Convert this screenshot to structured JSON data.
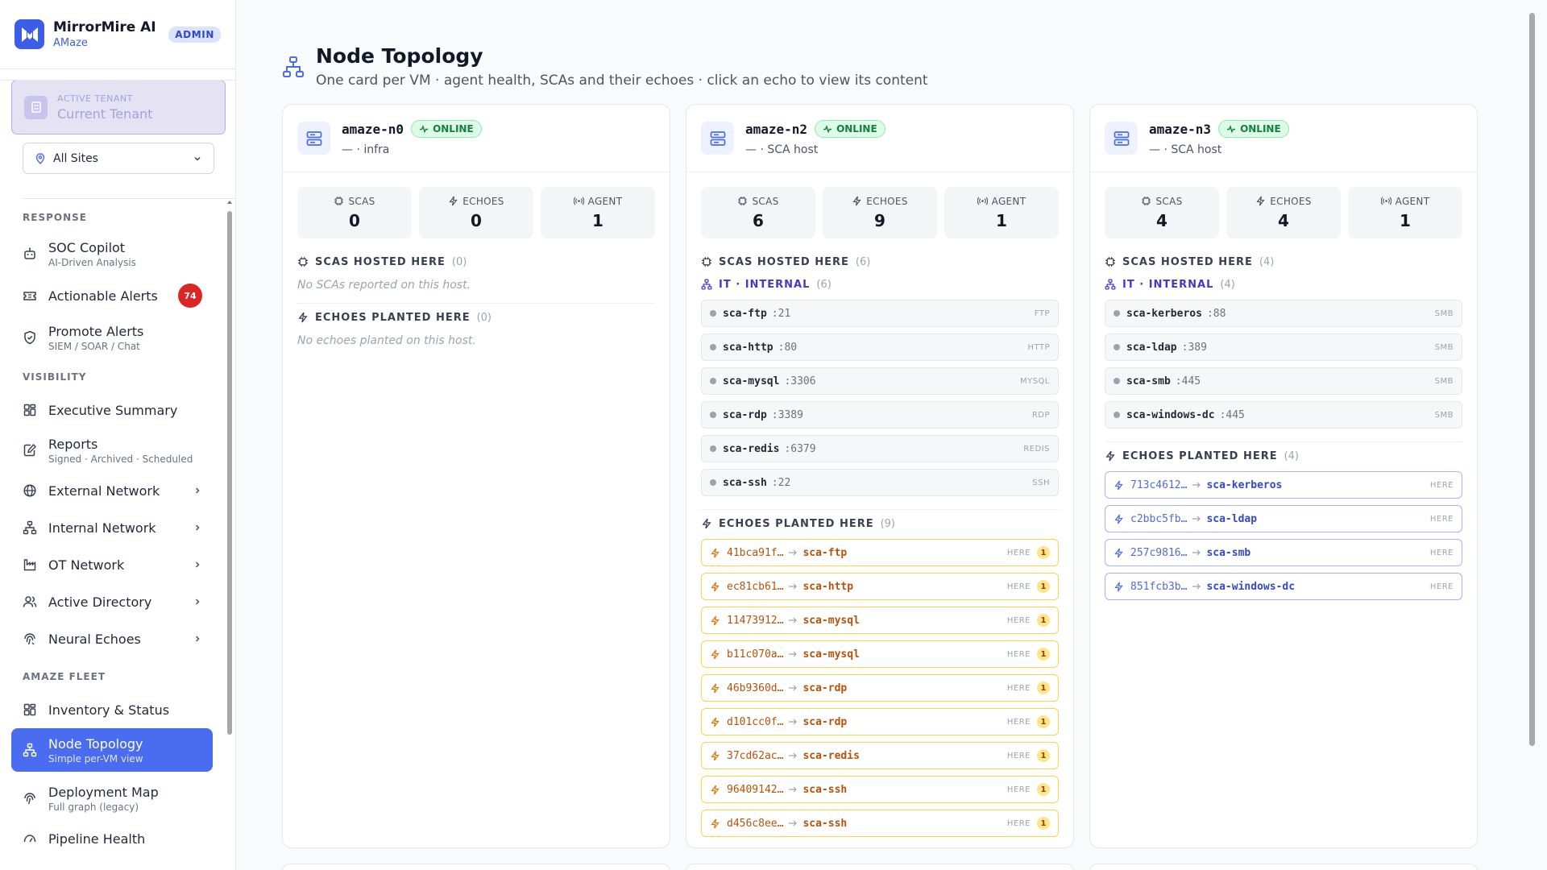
{
  "brand": {
    "name": "MirrorMire AI",
    "sub": "AMaze",
    "badge": "ADMIN"
  },
  "tenant": {
    "label": "ACTIVE TENANT",
    "value": "Current Tenant"
  },
  "site_select": {
    "value": "All Sites"
  },
  "nav": {
    "response": "RESPONSE",
    "soc_copilot": {
      "title": "SOC Copilot",
      "sub": "AI-Driven Analysis"
    },
    "actionable_alerts": {
      "title": "Actionable Alerts",
      "badge": "74"
    },
    "promote_alerts": {
      "title": "Promote Alerts",
      "sub": "SIEM / SOAR / Chat"
    },
    "visibility": "VISIBILITY",
    "executive_summary": {
      "title": "Executive Summary"
    },
    "reports": {
      "title": "Reports",
      "sub": "Signed · Archived · Scheduled"
    },
    "external_network": {
      "title": "External Network"
    },
    "internal_network": {
      "title": "Internal Network"
    },
    "ot_network": {
      "title": "OT Network"
    },
    "active_directory": {
      "title": "Active Directory"
    },
    "neural_echoes": {
      "title": "Neural Echoes"
    },
    "amaze_fleet": "AMAZE FLEET",
    "inventory_status": {
      "title": "Inventory & Status"
    },
    "node_topology": {
      "title": "Node Topology",
      "sub": "Simple per-VM view"
    },
    "deployment_map": {
      "title": "Deployment Map",
      "sub": "Full graph (legacy)"
    },
    "pipeline_health": {
      "title": "Pipeline Health"
    }
  },
  "page": {
    "title": "Node Topology",
    "subtitle": "One card per VM · agent health, SCAs and their echoes · click an echo to view its content"
  },
  "labels": {
    "scas": "SCAS",
    "echoes": "ECHOES",
    "agent": "AGENT",
    "online": "ONLINE",
    "scas_hosted": "SCAS HOSTED HERE",
    "echoes_planted": "ECHOES PLANTED HERE",
    "no_scas": "No SCAs reported on this host.",
    "no_echoes": "No echoes planted on this host.",
    "here": "HERE"
  },
  "colors": {
    "accent": "#4a6cf0",
    "online": "#15803d",
    "alert_badge": "#dc2626",
    "echo_warm": "#b45309",
    "echo_cool": "#3547c8"
  },
  "nodes": [
    {
      "name": "amaze-n0",
      "status": "ONLINE",
      "role": "— · infra",
      "scas": "0",
      "echoes": "0",
      "agent": "1",
      "scas_count": "(0)",
      "echoes_count": "(0)",
      "group": null,
      "sca_list": [],
      "echo_list": []
    },
    {
      "name": "amaze-n2",
      "status": "ONLINE",
      "role": "— · SCA host",
      "scas": "6",
      "echoes": "9",
      "agent": "1",
      "scas_count": "(6)",
      "echoes_count": "(9)",
      "group": {
        "name": "IT · INTERNAL",
        "count": "(6)"
      },
      "sca_list": [
        {
          "name": "sca-ftp",
          "port": ":21",
          "proto": "FTP"
        },
        {
          "name": "sca-http",
          "port": ":80",
          "proto": "HTTP"
        },
        {
          "name": "sca-mysql",
          "port": ":3306",
          "proto": "MYSQL"
        },
        {
          "name": "sca-rdp",
          "port": ":3389",
          "proto": "RDP"
        },
        {
          "name": "sca-redis",
          "port": ":6379",
          "proto": "REDIS"
        },
        {
          "name": "sca-ssh",
          "port": ":22",
          "proto": "SSH"
        }
      ],
      "echo_list": [
        {
          "id": "41bca91f…",
          "target": "sca-ftp",
          "tag": "HERE",
          "count": "1"
        },
        {
          "id": "ec81cb61…",
          "target": "sca-http",
          "tag": "HERE",
          "count": "1"
        },
        {
          "id": "11473912…",
          "target": "sca-mysql",
          "tag": "HERE",
          "count": "1"
        },
        {
          "id": "b11c070a…",
          "target": "sca-mysql",
          "tag": "HERE",
          "count": "1"
        },
        {
          "id": "46b9360d…",
          "target": "sca-rdp",
          "tag": "HERE",
          "count": "1"
        },
        {
          "id": "d101cc0f…",
          "target": "sca-rdp",
          "tag": "HERE",
          "count": "1"
        },
        {
          "id": "37cd62ac…",
          "target": "sca-redis",
          "tag": "HERE",
          "count": "1"
        },
        {
          "id": "96409142…",
          "target": "sca-ssh",
          "tag": "HERE",
          "count": "1"
        },
        {
          "id": "d456c8ee…",
          "target": "sca-ssh",
          "tag": "HERE",
          "count": "1"
        }
      ]
    },
    {
      "name": "amaze-n3",
      "status": "ONLINE",
      "role": "— · SCA host",
      "scas": "4",
      "echoes": "4",
      "agent": "1",
      "scas_count": "(4)",
      "echoes_count": "(4)",
      "group": {
        "name": "IT · INTERNAL",
        "count": "(4)"
      },
      "sca_list": [
        {
          "name": "sca-kerberos",
          "port": ":88",
          "proto": "SMB"
        },
        {
          "name": "sca-ldap",
          "port": ":389",
          "proto": "SMB"
        },
        {
          "name": "sca-smb",
          "port": ":445",
          "proto": "SMB"
        },
        {
          "name": "sca-windows-dc",
          "port": ":445",
          "proto": "SMB"
        }
      ],
      "echo_list": [
        {
          "id": "713c4612…",
          "target": "sca-kerberos",
          "tag": "HERE"
        },
        {
          "id": "c2bbc5fb…",
          "target": "sca-ldap",
          "tag": "HERE"
        },
        {
          "id": "257c9816…",
          "target": "sca-smb",
          "tag": "HERE"
        },
        {
          "id": "851fcb3b…",
          "target": "sca-windows-dc",
          "tag": "HERE"
        }
      ]
    }
  ]
}
